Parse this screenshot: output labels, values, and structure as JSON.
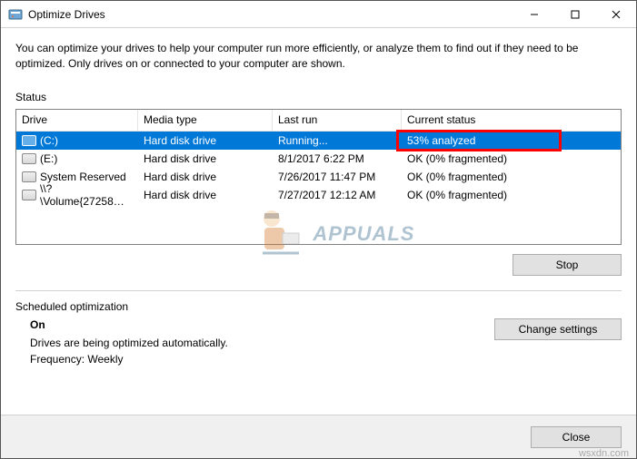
{
  "window": {
    "title": "Optimize Drives"
  },
  "intro": "You can optimize your drives to help your computer run more efficiently, or analyze them to find out if they need to be optimized. Only drives on or connected to your computer are shown.",
  "statusLabel": "Status",
  "columns": {
    "drive": "Drive",
    "media": "Media type",
    "last": "Last run",
    "status": "Current status"
  },
  "drives": [
    {
      "name": "(C:)",
      "media": "Hard disk drive",
      "last": "Running...",
      "status": "53% analyzed",
      "selected": true,
      "highlighted": true
    },
    {
      "name": "(E:)",
      "media": "Hard disk drive",
      "last": "8/1/2017 6:22 PM",
      "status": "OK (0% fragmented)",
      "selected": false
    },
    {
      "name": "System Reserved",
      "media": "Hard disk drive",
      "last": "7/26/2017 11:47 PM",
      "status": "OK (0% fragmented)",
      "selected": false
    },
    {
      "name": "\\\\?\\Volume{27258…",
      "media": "Hard disk drive",
      "last": "7/27/2017 12:12 AM",
      "status": "OK (0% fragmented)",
      "selected": false
    }
  ],
  "buttons": {
    "stop": "Stop",
    "changeSettings": "Change settings",
    "close": "Close"
  },
  "scheduled": {
    "heading": "Scheduled optimization",
    "on": "On",
    "desc": "Drives are being optimized automatically.",
    "freq": "Frequency: Weekly"
  },
  "watermark": {
    "brand": "APPUALS",
    "url": "wsxdn.com"
  }
}
